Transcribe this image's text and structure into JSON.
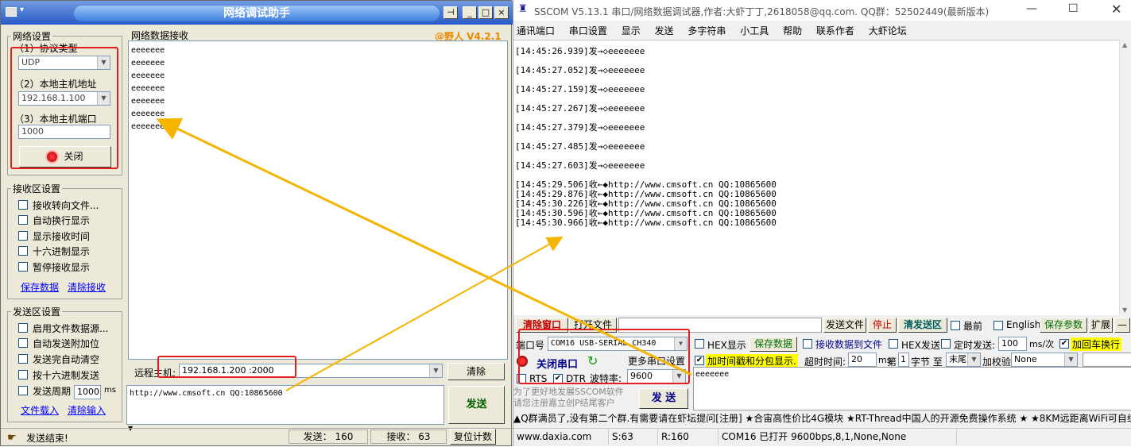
{
  "left": {
    "title": "网络调试助手",
    "brand": "@野人 V4.2.1",
    "net": {
      "legend": "网络设置",
      "protocol_label": "（1）协议类型",
      "protocol_value": "UDP",
      "host_label": "（2）本地主机地址",
      "host_value": "192.168.1.100",
      "port_label": "（3）本地主机端口",
      "port_value": "1000",
      "close_label": "关闭"
    },
    "recv_settings": {
      "legend": "接收区设置",
      "options": [
        "接收转向文件...",
        "自动换行显示",
        "显示接收时间",
        "十六进制显示",
        "暂停接收显示"
      ],
      "save": "保存数据",
      "clear": "清除接收"
    },
    "send_settings": {
      "legend": "发送区设置",
      "options": [
        "启用文件数据源...",
        "自动发送附加位",
        "发送完自动清空",
        "按十六进制发送",
        "发送周期"
      ],
      "period_value": "1000",
      "period_unit": "ms",
      "load": "文件载入",
      "clear": "清除输入"
    },
    "recv_legend": "网络数据接收",
    "recv_lines": [
      "eeeeeee",
      "eeeeeee",
      "eeeeeee",
      "eeeeeee",
      "eeeeeee",
      "eeeeeee",
      "eeeeeee"
    ],
    "remote_label": "远程主机:",
    "remote_value": "192.168.1.200 :2000",
    "clear_btn": "清除",
    "send_text": "http://www.cmsoft.cn QQ:10865600",
    "send_btn": "发送",
    "status": "发送结束!",
    "send_count_label": "发送：",
    "send_count": "160",
    "recv_count_label": "接收：",
    "recv_count": "63",
    "reset_btn": "复位计数"
  },
  "right": {
    "title": "SSCOM V5.13.1 串口/网络数据调试器,作者:大虾丁丁,2618058@qq.com. QQ群：52502449(最新版本)",
    "menu": [
      "通讯端口",
      "串口设置",
      "显示",
      "发送",
      "多字符串",
      "小工具",
      "帮助",
      "联系作者",
      "大虾论坛"
    ],
    "sent_lines": [
      "[14:45:26.939]发→◇eeeeeee",
      "[14:45:27.052]发→◇eeeeeee",
      "[14:45:27.159]发→◇eeeeeee",
      "[14:45:27.267]发→◇eeeeeee",
      "[14:45:27.379]发→◇eeeeeee",
      "[14:45:27.485]发→◇eeeeeee",
      "[14:45:27.603]发→◇eeeeeee"
    ],
    "recv_lines": [
      "[14:45:29.506]收←◆http://www.cmsoft.cn QQ:10865600",
      "[14:45:29.876]收←◆http://www.cmsoft.cn QQ:10865600",
      "[14:45:30.226]收←◆http://www.cmsoft.cn QQ:10865600",
      "[14:45:30.596]收←◆http://www.cmsoft.cn QQ:10865600",
      "[14:45:30.966]收←◆http://www.cmsoft.cn QQ:10865600"
    ],
    "toolbar": {
      "clear_window": "清除窗口",
      "open_file": "打开文件",
      "send_file": "发送文件",
      "stop": "停止",
      "clear_send": "清发送区",
      "topmost": "最前",
      "english": "English",
      "save_params": "保存参数",
      "expand": "扩展",
      "minus": "—"
    },
    "port_label": "端口号",
    "port_value": "COM16 USB-SERIAL CH340",
    "hex_display": "HEX显示",
    "save_data": "保存数据",
    "recv_to_file": "接收数据到文件",
    "hex_send": "HEX发送",
    "timed_send": "定时发送:",
    "timed_value": "100",
    "timed_unit": "ms/次",
    "add_crlf": "加回车换行",
    "close_port": "关闭串口",
    "more_settings": "更多串口设置",
    "timestamp": "加时间戳和分包显示.",
    "timeout_label": "超时时间:",
    "timeout_value": "20",
    "timeout_unit": "ms",
    "byte_no_label": "第",
    "byte_no": "1",
    "byte_label": "字节 至",
    "byte_end": "末尾",
    "checksum_label": "加校验",
    "checksum_value": "None",
    "rts": "RTS",
    "dtr": "DTR",
    "baud_label": "波特率:",
    "baud_value": "9600",
    "send_box_text": "eeeeeee",
    "promo": "为了更好地发展SSCOM软件\n请您注册嘉立创P结尾客户",
    "send_btn": "发 送",
    "ticker": "▲Q群满员了,没有第二个群.有需要请在虾坛提问[注册] ★合宙高性价比4G模块 ★RT-Thread中国人的开源免费操作系统 ★ ★8KM远距离WiFi可自组",
    "status": {
      "site": "www.daxia.com",
      "s": "S:63",
      "r": "R:160",
      "port": "COM16 已打开  9600bps,8,1,None,None"
    }
  }
}
